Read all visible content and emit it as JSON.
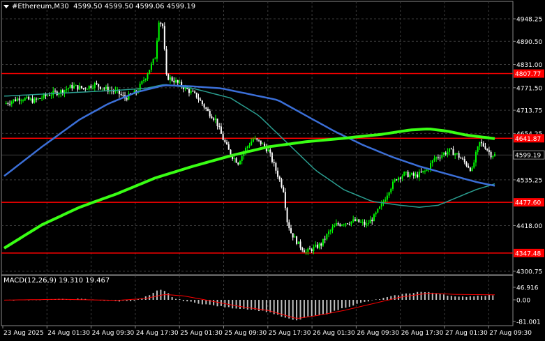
{
  "header": {
    "symbol": "#Ethereum,M30",
    "ohlc": "4599.50 4599.50 4599.06 4599.19"
  },
  "macd_panel": {
    "label": "MACD(12,26,9) 19.310 19.467"
  },
  "colors": {
    "background": "#000000",
    "bull_candle": "#00ff00",
    "bear_candle": "#ffffff",
    "sr_line": "#ff0000",
    "ma_fast": "#2a9d8f",
    "ma_mid": "#3b6fd8",
    "ma_slow": "#39ff14",
    "macd_hist": "#c0c0c0",
    "macd_signal": "#ff0000",
    "current_price_label": "#000000"
  },
  "chart_data": [
    {
      "type": "candlestick",
      "timeframe": "M30",
      "ylim": [
        4300.75,
        4948.25
      ],
      "y_ticks": [
        "4948.25",
        "4890.50",
        "4831.00",
        "4771.50",
        "4713.75",
        "4654.25",
        "4535.25",
        "4418.00",
        "4300.75"
      ],
      "x_ticks": [
        "23 Aug 2025",
        "24 Aug 01:30",
        "24 Aug 09:30",
        "24 Aug 17:30",
        "25 Aug 01:30",
        "25 Aug 09:30",
        "25 Aug 17:30",
        "26 Aug 01:30",
        "26 Aug 09:30",
        "26 Aug 17:30",
        "27 Aug 01:30",
        "27 Aug 09:30"
      ],
      "horizontal_levels": [
        {
          "label": "4807.77",
          "value": 4807.77
        },
        {
          "label": "4641.87",
          "value": 4641.87
        },
        {
          "label": "4477.60",
          "value": 4477.6
        },
        {
          "label": "4347.48",
          "value": 4347.48
        }
      ],
      "current_price": {
        "label": "4599.19",
        "value": 4599.19
      },
      "close_path": [
        [
          0,
          4730
        ],
        [
          8,
          4745
        ],
        [
          16,
          4738
        ],
        [
          24,
          4755
        ],
        [
          30,
          4762
        ],
        [
          36,
          4775
        ],
        [
          42,
          4770
        ],
        [
          48,
          4780
        ],
        [
          54,
          4768
        ],
        [
          60,
          4760
        ],
        [
          64,
          4745
        ],
        [
          70,
          4760
        ],
        [
          75,
          4800
        ],
        [
          78,
          4830
        ],
        [
          80,
          4850
        ],
        [
          82,
          4945
        ],
        [
          84,
          4930
        ],
        [
          86,
          4800
        ],
        [
          90,
          4790
        ],
        [
          96,
          4770
        ],
        [
          102,
          4750
        ],
        [
          108,
          4710
        ],
        [
          112,
          4690
        ],
        [
          116,
          4640
        ],
        [
          120,
          4600
        ],
        [
          124,
          4580
        ],
        [
          128,
          4615
        ],
        [
          132,
          4640
        ],
        [
          136,
          4630
        ],
        [
          140,
          4610
        ],
        [
          144,
          4560
        ],
        [
          148,
          4510
        ],
        [
          150,
          4430
        ],
        [
          152,
          4400
        ],
        [
          156,
          4370
        ],
        [
          160,
          4350
        ],
        [
          164,
          4360
        ],
        [
          168,
          4370
        ],
        [
          172,
          4400
        ],
        [
          176,
          4420
        ],
        [
          180,
          4425
        ],
        [
          186,
          4430
        ],
        [
          192,
          4420
        ],
        [
          196,
          4440
        ],
        [
          200,
          4470
        ],
        [
          204,
          4510
        ],
        [
          208,
          4540
        ],
        [
          212,
          4550
        ],
        [
          218,
          4545
        ],
        [
          224,
          4560
        ],
        [
          228,
          4590
        ],
        [
          232,
          4600
        ],
        [
          236,
          4610
        ],
        [
          240,
          4600
        ],
        [
          244,
          4580
        ],
        [
          248,
          4560
        ],
        [
          250,
          4600
        ],
        [
          252,
          4630
        ],
        [
          255,
          4620
        ],
        [
          258,
          4600
        ],
        [
          260,
          4599.19
        ]
      ],
      "ma_fast": [
        [
          0,
          4750
        ],
        [
          20,
          4755
        ],
        [
          40,
          4760
        ],
        [
          60,
          4765
        ],
        [
          75,
          4770
        ],
        [
          85,
          4780
        ],
        [
          100,
          4770
        ],
        [
          120,
          4745
        ],
        [
          135,
          4700
        ],
        [
          150,
          4630
        ],
        [
          165,
          4560
        ],
        [
          180,
          4510
        ],
        [
          195,
          4480
        ],
        [
          210,
          4470
        ],
        [
          220,
          4465
        ],
        [
          230,
          4470
        ],
        [
          240,
          4490
        ],
        [
          250,
          4510
        ],
        [
          260,
          4525
        ]
      ],
      "ma_mid": [
        [
          0,
          4545
        ],
        [
          20,
          4620
        ],
        [
          40,
          4690
        ],
        [
          55,
          4730
        ],
        [
          70,
          4760
        ],
        [
          85,
          4778
        ],
        [
          100,
          4775
        ],
        [
          115,
          4770
        ],
        [
          130,
          4755
        ],
        [
          145,
          4740
        ],
        [
          160,
          4700
        ],
        [
          175,
          4660
        ],
        [
          190,
          4625
        ],
        [
          205,
          4595
        ],
        [
          220,
          4570
        ],
        [
          235,
          4550
        ],
        [
          250,
          4530
        ],
        [
          260,
          4520
        ]
      ],
      "ma_slow": [
        [
          0,
          4360
        ],
        [
          20,
          4420
        ],
        [
          40,
          4465
        ],
        [
          60,
          4500
        ],
        [
          80,
          4540
        ],
        [
          100,
          4570
        ],
        [
          120,
          4597
        ],
        [
          140,
          4620
        ],
        [
          160,
          4633
        ],
        [
          180,
          4642
        ],
        [
          200,
          4652
        ],
        [
          215,
          4663
        ],
        [
          225,
          4666
        ],
        [
          235,
          4660
        ],
        [
          245,
          4650
        ],
        [
          260,
          4641
        ]
      ]
    },
    {
      "type": "bar",
      "name": "MACD(12,26,9)",
      "ylim": [
        -81.001,
        46.916
      ],
      "y_ticks": [
        "46.916",
        "0.00",
        "-81.001"
      ],
      "main": 19.31,
      "signal": 19.467,
      "hist_path": [
        [
          0,
          -2
        ],
        [
          20,
          1
        ],
        [
          40,
          3
        ],
        [
          60,
          -5
        ],
        [
          70,
          -2
        ],
        [
          78,
          20
        ],
        [
          82,
          38
        ],
        [
          86,
          30
        ],
        [
          90,
          5
        ],
        [
          100,
          -10
        ],
        [
          110,
          -20
        ],
        [
          120,
          -30
        ],
        [
          130,
          -35
        ],
        [
          140,
          -45
        ],
        [
          150,
          -70
        ],
        [
          155,
          -78
        ],
        [
          160,
          -65
        ],
        [
          170,
          -55
        ],
        [
          180,
          -30
        ],
        [
          190,
          -10
        ],
        [
          200,
          5
        ],
        [
          210,
          20
        ],
        [
          220,
          30
        ],
        [
          230,
          25
        ],
        [
          240,
          10
        ],
        [
          250,
          15
        ],
        [
          260,
          18
        ]
      ],
      "signal_path": [
        [
          0,
          -1
        ],
        [
          30,
          2
        ],
        [
          60,
          -2
        ],
        [
          75,
          5
        ],
        [
          85,
          20
        ],
        [
          95,
          15
        ],
        [
          110,
          -5
        ],
        [
          125,
          -25
        ],
        [
          140,
          -40
        ],
        [
          155,
          -70
        ],
        [
          165,
          -60
        ],
        [
          180,
          -40
        ],
        [
          195,
          -15
        ],
        [
          210,
          10
        ],
        [
          225,
          25
        ],
        [
          240,
          20
        ],
        [
          260,
          19
        ]
      ]
    }
  ]
}
